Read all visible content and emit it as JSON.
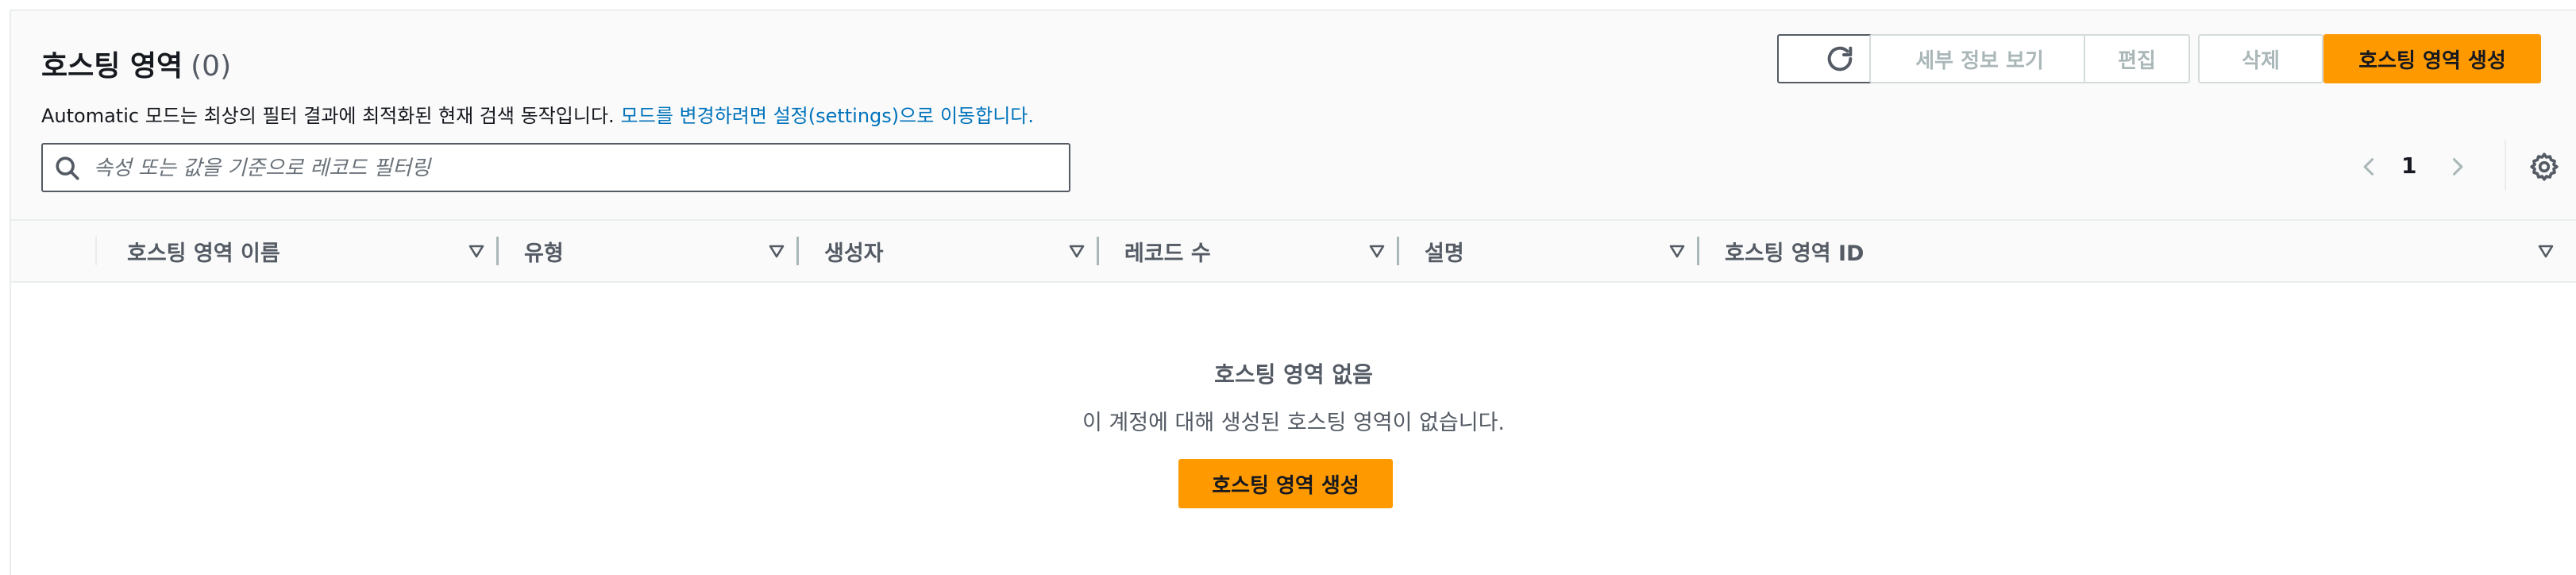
{
  "header": {
    "title": "호스팅 영역",
    "count": "(0)",
    "description": "Automatic 모드는 최상의 필터 결과에 최적화된 현재 검색 동작입니다.",
    "settings_link": "모드를 변경하려면 설정(settings)으로 이동합니다."
  },
  "toolbar": {
    "refresh_icon": "refresh-icon",
    "details_label": "세부 정보 보기",
    "edit_label": "편집",
    "delete_label": "삭제",
    "create_label": "호스팅 영역 생성"
  },
  "search": {
    "placeholder": "속성 또는 값을 기준으로 레코드 필터링",
    "value": ""
  },
  "pagination": {
    "current_page": "1"
  },
  "table": {
    "columns": [
      {
        "label": "호스팅 영역 이름"
      },
      {
        "label": "유형"
      },
      {
        "label": "생성자"
      },
      {
        "label": "레코드 수"
      },
      {
        "label": "설명"
      },
      {
        "label": "호스팅 영역 ID"
      }
    ],
    "rows": []
  },
  "empty_state": {
    "title": "호스팅 영역 없음",
    "description": "이 계정에 대해 생성된 호스팅 영역이 없습니다.",
    "button_label": "호스팅 영역 생성"
  },
  "colors": {
    "primary": "#ff9900",
    "link": "#0073bb",
    "text": "#16191f",
    "muted": "#545b64",
    "disabled": "#aab7b8"
  }
}
